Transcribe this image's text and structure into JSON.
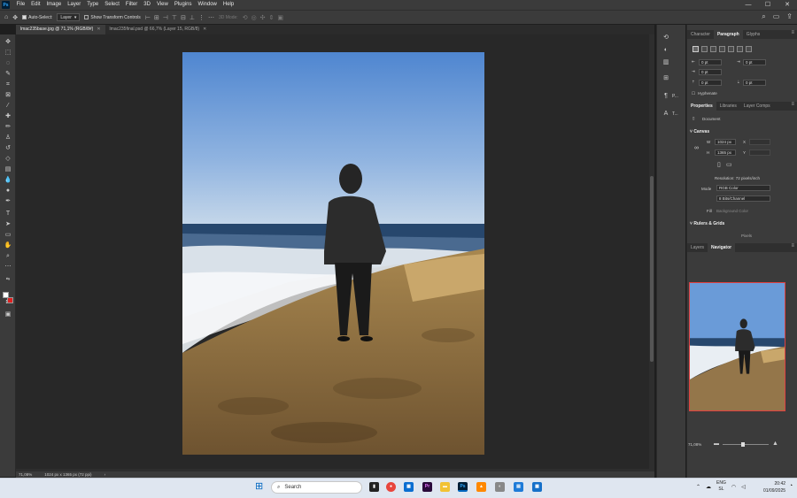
{
  "menubar": {
    "logo": "Ps",
    "items": [
      "File",
      "Edit",
      "Image",
      "Layer",
      "Type",
      "Select",
      "Filter",
      "3D",
      "View",
      "Plugins",
      "Window",
      "Help"
    ],
    "window_controls": [
      "—",
      "☐",
      "✕"
    ]
  },
  "options": {
    "auto_select_label": "Auto-Select:",
    "auto_select_target": "Layer",
    "show_transform_label": "Show Transform Controls",
    "mode_3d_label": "3D Mode:"
  },
  "tabs": [
    {
      "label": "lmac235base.jpg @ 71,1% (RGB/8#)",
      "active": true
    },
    {
      "label": "lmac235final.psd @ 66,7% (Layer 15, RGB/8)",
      "active": false
    }
  ],
  "status": {
    "zoom": "71,08%",
    "doc_info": "1024 px x 1365 px (72 ppi)"
  },
  "collapsed_panels": [
    {
      "icon": "history-icon",
      "label": ""
    },
    {
      "icon": "color-icon",
      "label": ""
    },
    {
      "icon": "libraries-icon",
      "label": ""
    },
    {
      "icon": "properties-icon",
      "label": ""
    },
    {
      "icon": "paragraph-icon",
      "label": "P..."
    },
    {
      "icon": "character-icon",
      "label": "T..."
    }
  ],
  "char_panel": {
    "tabs": [
      "Character",
      "Paragraph",
      "Glyphs"
    ],
    "active": 1,
    "indent_values": [
      "0 pt",
      "0 pt",
      "0 pt",
      "0 pt",
      "0 pt"
    ],
    "hyphenate_label": "Hyphenate"
  },
  "props_panel": {
    "tabs": [
      "Properties",
      "Libraries",
      "Layer Comps"
    ],
    "active": 0,
    "doc_label": "Document",
    "canvas_section": "Canvas",
    "width_label": "W",
    "width_value": "1024 px",
    "height_label": "H",
    "height_value": "1365 px",
    "x_label": "X",
    "y_label": "Y",
    "resolution": "Resolution: 72 pixels/inch",
    "mode_label": "Mode",
    "mode_value": "RGB Color",
    "depth_value": "8 Bits/Channel",
    "fill_label": "Fill",
    "fill_value": "Background Color",
    "rulers_section": "Rulers & Grids",
    "rulers_unit": "Pixels"
  },
  "nav_panel": {
    "tabs": [
      "Layers",
      "Navigator"
    ],
    "active": 1,
    "zoom": "71,08%"
  },
  "taskbar": {
    "search_placeholder": "Search",
    "language": "ENG",
    "region": "SL",
    "time": "20:42",
    "date": "01/09/2025"
  }
}
